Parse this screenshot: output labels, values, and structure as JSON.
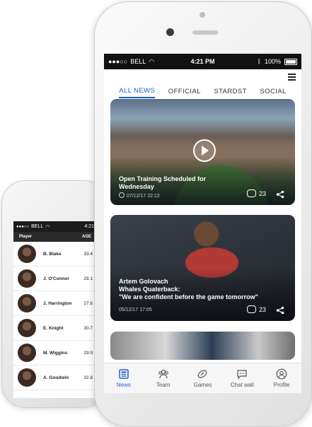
{
  "back_phone": {
    "status": {
      "signal": "●●●○○",
      "carrier": "BELL",
      "time": "4:21"
    },
    "header": {
      "player_label": "Player",
      "age_label": "AGE"
    },
    "players": [
      {
        "name": "B. Blake",
        "age": "33.4"
      },
      {
        "name": "J. O'Connor",
        "age": "29.1"
      },
      {
        "name": "J. Harrington",
        "age": "27.6"
      },
      {
        "name": "E. Knight",
        "age": "30.7"
      },
      {
        "name": "M. Wiggins",
        "age": "29.9"
      },
      {
        "name": "A. Goodwin",
        "age": "32.8"
      }
    ]
  },
  "front_phone": {
    "status": {
      "signal": "●●●○○",
      "carrier": "BELL",
      "time": "4:21 PM",
      "battery": "100%"
    },
    "tabs": [
      {
        "label": "ALL NEWS"
      },
      {
        "label": "OFFICIAL"
      },
      {
        "label": "STARDST"
      },
      {
        "label": "SOCIAL"
      }
    ],
    "cards": [
      {
        "title_line1": "Open Training Scheduled for",
        "title_line2": "Wednesday",
        "date": "07/12/17 22:12",
        "comments": "23"
      },
      {
        "title_line1": "Artem Golovach",
        "title_line2": "Whales Quaterback:",
        "title_line3": "\"We are confident before the game tomorrow\"",
        "date": "05/12/17 17:05",
        "comments": "23"
      }
    ],
    "nav": [
      {
        "label": "News"
      },
      {
        "label": "Team"
      },
      {
        "label": "Games"
      },
      {
        "label": "Chat wall"
      },
      {
        "label": "Profile"
      }
    ],
    "accent_color": "#1d60c4"
  }
}
